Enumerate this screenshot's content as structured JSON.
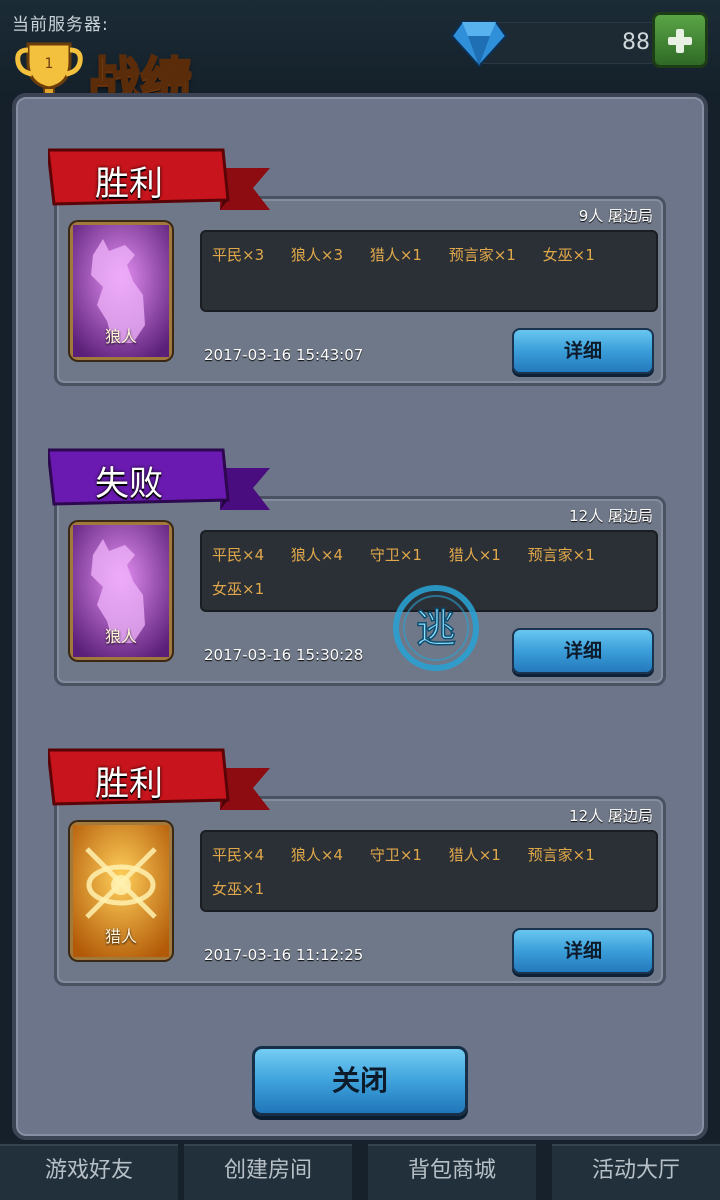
{
  "header": {
    "server_label": "当前服务器:",
    "title": "战绩",
    "gem_count": "88"
  },
  "records": [
    {
      "result": "胜利",
      "result_color": "#c8141c",
      "meta": "9人 屠边局",
      "roles": [
        "平民×3",
        "狼人×3",
        "猎人×1",
        "预言家×1",
        "女巫×1"
      ],
      "avatar_role": "狼人",
      "avatar_icon": "werewolf-icon",
      "timestamp": "2017-03-16 15:43:07",
      "detail_label": "详细"
    },
    {
      "result": "失败",
      "result_color": "#6a1ab0",
      "meta": "12人 屠边局",
      "roles": [
        "平民×4",
        "狼人×4",
        "守卫×1",
        "猎人×1",
        "预言家×1",
        "女巫×1"
      ],
      "avatar_role": "狼人",
      "avatar_icon": "werewolf-icon",
      "timestamp": "2017-03-16 15:30:28",
      "detail_label": "详细",
      "badge": "逃"
    },
    {
      "result": "胜利",
      "result_color": "#c8141c",
      "meta": "12人 屠边局",
      "roles": [
        "平民×4",
        "狼人×4",
        "守卫×1",
        "猎人×1",
        "预言家×1",
        "女巫×1"
      ],
      "avatar_role": "猎人",
      "avatar_icon": "hunter-icon",
      "timestamp": "2017-03-16 11:12:25",
      "detail_label": "详细"
    }
  ],
  "close_label": "关闭",
  "nav": [
    "游戏好友",
    "创建房间",
    "背包商城",
    "活动大厅"
  ]
}
